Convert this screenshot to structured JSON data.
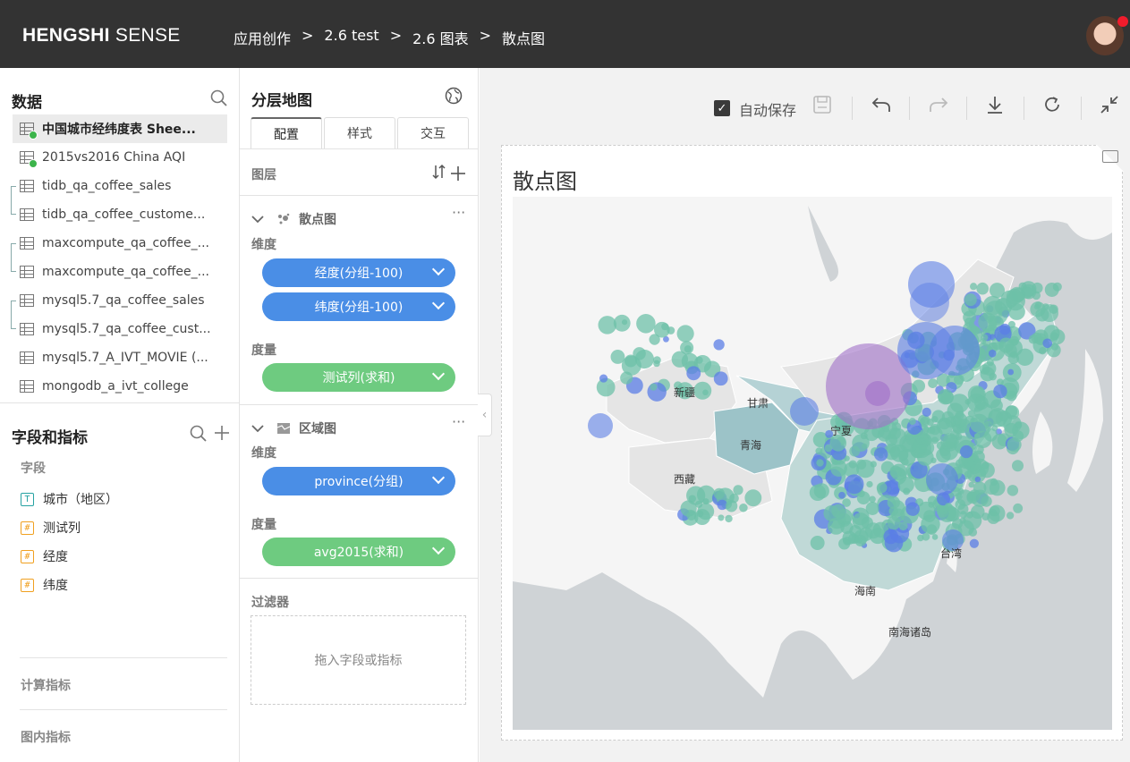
{
  "header": {
    "logo_bold": "HENGSHI",
    "logo_light": " SENSE",
    "breadcrumbs": [
      "应用创作",
      "2.6 test",
      "2.6 图表",
      "散点图"
    ],
    "separator": ">"
  },
  "data_panel": {
    "title": "数据",
    "datasets": [
      {
        "label": "中国城市经纬度表 Shee...",
        "active": true,
        "ok": true
      },
      {
        "label": "2015vs2016 China AQI",
        "active": false,
        "ok": true
      },
      {
        "label": "tidb_qa_coffee_sales"
      },
      {
        "label": "tidb_qa_coffee_custome..."
      },
      {
        "label": "maxcompute_qa_coffee_..."
      },
      {
        "label": "maxcompute_qa_coffee_..."
      },
      {
        "label": "mysql5.7_qa_coffee_sales"
      },
      {
        "label": "mysql5.7_qa_coffee_cust..."
      },
      {
        "label": "mysql5.7_A_IVT_MOVIE (..."
      },
      {
        "label": "mongodb_a_ivt_college"
      }
    ]
  },
  "fields_panel": {
    "title": "字段和指标",
    "fields_label": "字段",
    "fields": [
      {
        "type": "T",
        "label": "城市（地区）"
      },
      {
        "type": "#",
        "label": "测试列"
      },
      {
        "type": "#",
        "label": "经度"
      },
      {
        "type": "#",
        "label": "纬度"
      }
    ],
    "calc_label": "计算指标",
    "inner_label": "图内指标"
  },
  "config_panel": {
    "title": "分层地图",
    "tabs": [
      "配置",
      "样式",
      "交互"
    ],
    "layers_label": "图层",
    "layer1": {
      "name": "散点图",
      "dim_label": "维度",
      "dims": [
        "经度(分组-100)",
        "纬度(分组-100)"
      ],
      "measure_label": "度量",
      "measures": [
        "测试列(求和)"
      ]
    },
    "layer2": {
      "name": "区域图",
      "dim_label": "维度",
      "dims": [
        "province(分组)"
      ],
      "measure_label": "度量",
      "measures": [
        "avg2015(求和)"
      ]
    },
    "filter_label": "过滤器",
    "dropzone_text": "拖入字段或指标"
  },
  "toolbar": {
    "autosave_label": "自动保存",
    "autosave_checked": true
  },
  "chart": {
    "title": "散点图",
    "map_labels": [
      "新疆",
      "甘肃",
      "青海",
      "西藏",
      "宁夏",
      "海南",
      "台湾",
      "南海诸岛"
    ],
    "colors": {
      "blue": "#5b7ee5",
      "teal": "#6ec0a8",
      "purple": "#a070c8",
      "region_light": "#e8e8e8",
      "region_teal": "#9cc3c8"
    }
  }
}
